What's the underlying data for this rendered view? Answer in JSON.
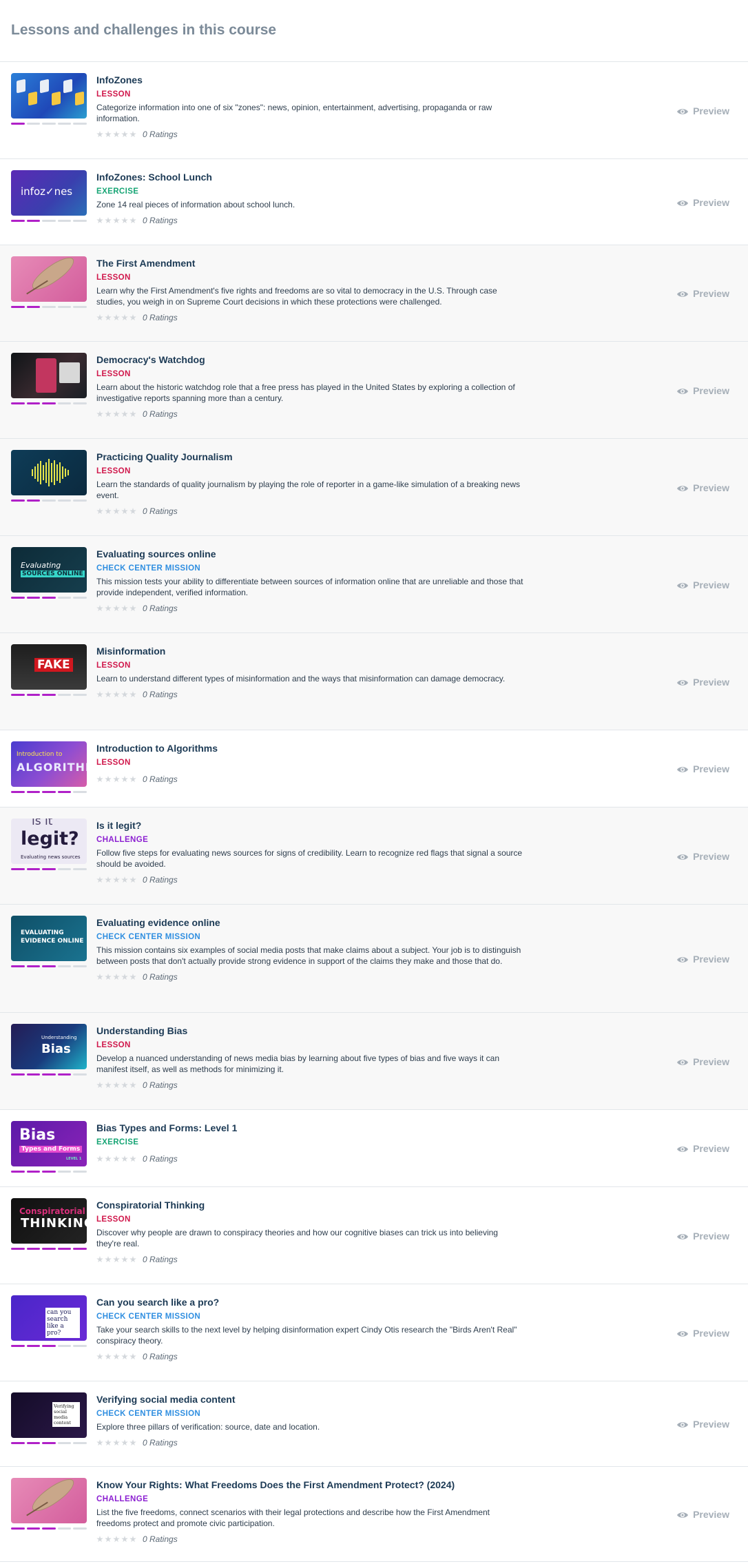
{
  "page": {
    "title": "Lessons and challenges in this course"
  },
  "preview_label": "Preview",
  "rating_label": "0 Ratings",
  "items": [
    {
      "title": "InfoZones",
      "type": "LESSON",
      "kind": "lesson",
      "description": "Categorize information into one of six \"zones\": news, opinion, entertainment, advertising, propaganda or raw information.",
      "thumb": "infozones",
      "progress": [
        1,
        0,
        0,
        0,
        0
      ]
    },
    {
      "title": "InfoZones: School Lunch",
      "type": "EXERCISE",
      "kind": "exercise",
      "description": "Zone 14 real pieces of information about school lunch.",
      "thumb": "schoollunch",
      "thumb_text": "infoz✓nes",
      "progress": [
        1,
        1,
        0,
        0,
        0
      ]
    },
    {
      "title": "The First Amendment",
      "type": "LESSON",
      "kind": "lesson",
      "description": "Learn why the First Amendment's five rights and freedoms are so vital to democracy in the U.S. Through case studies, you weigh in on Supreme Court decisions in which these protections were challenged.",
      "thumb": "feather",
      "progress": [
        1,
        1,
        0,
        0,
        0
      ]
    },
    {
      "title": "Democracy's Watchdog",
      "type": "LESSON",
      "kind": "lesson",
      "description": "Learn about the historic watchdog role that a free press has played in the United States by exploring a collection of investigative reports spanning more than a century.",
      "thumb": "watchdog",
      "progress": [
        1,
        1,
        1,
        0,
        0
      ]
    },
    {
      "title": "Practicing Quality Journalism",
      "type": "LESSON",
      "kind": "lesson",
      "description": "Learn the standards of quality journalism by playing the role of reporter in a game-like simulation of a breaking news event.",
      "thumb": "journalism",
      "progress": [
        1,
        1,
        0,
        0,
        0
      ]
    },
    {
      "title": "Evaluating sources online",
      "type": "CHECK CENTER MISSION",
      "kind": "mission",
      "description": "This mission tests your ability to differentiate between sources of information online that are unreliable and those that provide independent, verified information.",
      "thumb": "evalsources",
      "thumb_text": "Evaluating",
      "thumb_text2": "SOURCES ONLINE",
      "progress": [
        1,
        1,
        1,
        0,
        0
      ]
    },
    {
      "title": "Misinformation",
      "type": "LESSON",
      "kind": "lesson",
      "description": "Learn to understand different types of misinformation and the ways that misinformation can damage democracy.",
      "thumb": "misinfo",
      "thumb_text": "FAKE",
      "progress": [
        1,
        1,
        1,
        0,
        0
      ]
    },
    {
      "title": "Introduction to Algorithms",
      "type": "LESSON",
      "kind": "lesson",
      "description": "",
      "thumb": "algos",
      "thumb_text": "Introduction to",
      "thumb_text2": "ALGORITHMS",
      "progress": [
        1,
        1,
        1,
        1,
        0
      ]
    },
    {
      "title": "Is it legit?",
      "type": "CHALLENGE",
      "kind": "challenge",
      "description": "Follow five steps for evaluating news sources for signs of credibility. Learn to recognize red flags that signal a source should be avoided.",
      "thumb": "legit",
      "thumb_text": "is it",
      "thumb_text2": "legit?",
      "thumb_text3": "Evaluating news sources",
      "progress": [
        1,
        1,
        1,
        0,
        0
      ]
    },
    {
      "title": "Evaluating evidence online",
      "type": "CHECK CENTER MISSION",
      "kind": "mission",
      "description": "This mission contains six examples of social media posts that make claims about a subject. Your job is to distinguish between posts that don't actually provide strong evidence in support of the claims they make and those that do.",
      "thumb": "evalevidence",
      "thumb_text": "EVALUATING",
      "thumb_text2": "EVIDENCE ONLINE",
      "progress": [
        1,
        1,
        1,
        0,
        0
      ]
    },
    {
      "title": "Understanding Bias",
      "type": "LESSON",
      "kind": "lesson",
      "description": "Develop a nuanced understanding of news media bias by learning about five types of bias and five ways it can manifest itself, as well as methods for minimizing it.",
      "thumb": "bias",
      "thumb_text": "Understanding",
      "thumb_text2": "Bias",
      "progress": [
        1,
        1,
        1,
        1,
        0
      ]
    },
    {
      "title": "Bias Types and Forms: Level 1",
      "type": "EXERCISE",
      "kind": "exercise",
      "description": "",
      "thumb": "biastypes",
      "thumb_text": "Bias",
      "thumb_text2": "Types and Forms",
      "thumb_text3": "LEVEL 1",
      "progress": [
        1,
        1,
        1,
        0,
        0
      ]
    },
    {
      "title": "Conspiratorial Thinking",
      "type": "LESSON",
      "kind": "lesson",
      "description": "Discover why people are drawn to conspiracy theories and how our cognitive biases can trick us into believing they're real.",
      "thumb": "conspire",
      "thumb_text": "Conspiratorial",
      "thumb_text2": "THINKING",
      "progress": [
        1,
        1,
        1,
        1,
        1
      ]
    },
    {
      "title": "Can you search like a pro?",
      "type": "CHECK CENTER MISSION",
      "kind": "mission",
      "description": "Take your search skills to the next level by helping disinformation expert Cindy Otis research the \"Birds Aren't Real\" conspiracy theory.",
      "thumb": "searchpro",
      "thumb_text": "can you search like a pro?",
      "progress": [
        1,
        1,
        1,
        0,
        0
      ]
    },
    {
      "title": "Verifying social media content",
      "type": "CHECK CENTER MISSION",
      "kind": "mission",
      "description": "Explore three pillars of verification: source, date and location.",
      "thumb": "verify",
      "thumb_text": "Verifying social media content",
      "progress": [
        1,
        1,
        1,
        0,
        0
      ]
    },
    {
      "title": "Know Your Rights: What Freedoms Does the First Amendment Protect? (2024)",
      "type": "CHALLENGE",
      "kind": "challenge",
      "description": "List the five freedoms, connect scenarios with their legal protections and describe how the First Amendment freedoms protect and promote civic participation.",
      "thumb": "feather",
      "progress": [
        1,
        1,
        1,
        0,
        0
      ]
    }
  ]
}
